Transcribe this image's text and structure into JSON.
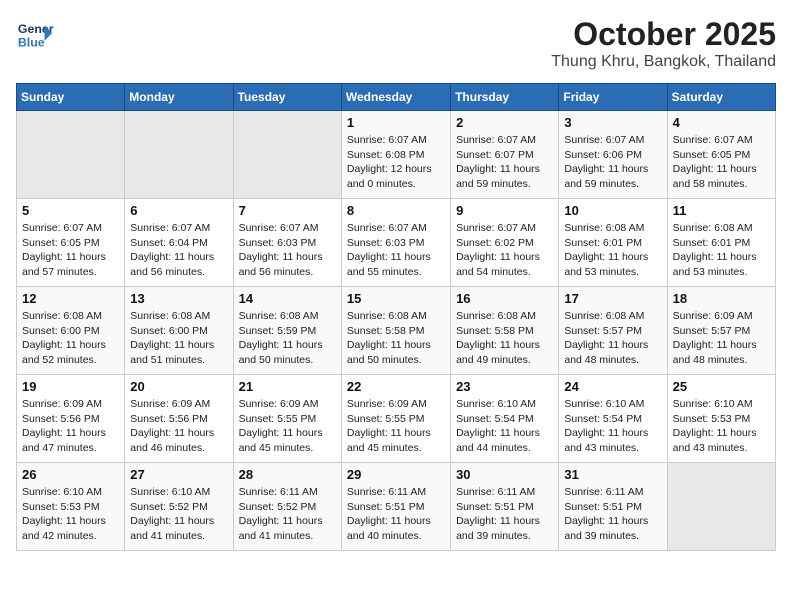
{
  "header": {
    "logo_general": "General",
    "logo_blue": "Blue",
    "month": "October 2025",
    "location": "Thung Khru, Bangkok, Thailand"
  },
  "weekdays": [
    "Sunday",
    "Monday",
    "Tuesday",
    "Wednesday",
    "Thursday",
    "Friday",
    "Saturday"
  ],
  "weeks": [
    [
      {
        "day": "",
        "detail": ""
      },
      {
        "day": "",
        "detail": ""
      },
      {
        "day": "",
        "detail": ""
      },
      {
        "day": "1",
        "detail": "Sunrise: 6:07 AM\nSunset: 6:08 PM\nDaylight: 12 hours\nand 0 minutes."
      },
      {
        "day": "2",
        "detail": "Sunrise: 6:07 AM\nSunset: 6:07 PM\nDaylight: 11 hours\nand 59 minutes."
      },
      {
        "day": "3",
        "detail": "Sunrise: 6:07 AM\nSunset: 6:06 PM\nDaylight: 11 hours\nand 59 minutes."
      },
      {
        "day": "4",
        "detail": "Sunrise: 6:07 AM\nSunset: 6:05 PM\nDaylight: 11 hours\nand 58 minutes."
      }
    ],
    [
      {
        "day": "5",
        "detail": "Sunrise: 6:07 AM\nSunset: 6:05 PM\nDaylight: 11 hours\nand 57 minutes."
      },
      {
        "day": "6",
        "detail": "Sunrise: 6:07 AM\nSunset: 6:04 PM\nDaylight: 11 hours\nand 56 minutes."
      },
      {
        "day": "7",
        "detail": "Sunrise: 6:07 AM\nSunset: 6:03 PM\nDaylight: 11 hours\nand 56 minutes."
      },
      {
        "day": "8",
        "detail": "Sunrise: 6:07 AM\nSunset: 6:03 PM\nDaylight: 11 hours\nand 55 minutes."
      },
      {
        "day": "9",
        "detail": "Sunrise: 6:07 AM\nSunset: 6:02 PM\nDaylight: 11 hours\nand 54 minutes."
      },
      {
        "day": "10",
        "detail": "Sunrise: 6:08 AM\nSunset: 6:01 PM\nDaylight: 11 hours\nand 53 minutes."
      },
      {
        "day": "11",
        "detail": "Sunrise: 6:08 AM\nSunset: 6:01 PM\nDaylight: 11 hours\nand 53 minutes."
      }
    ],
    [
      {
        "day": "12",
        "detail": "Sunrise: 6:08 AM\nSunset: 6:00 PM\nDaylight: 11 hours\nand 52 minutes."
      },
      {
        "day": "13",
        "detail": "Sunrise: 6:08 AM\nSunset: 6:00 PM\nDaylight: 11 hours\nand 51 minutes."
      },
      {
        "day": "14",
        "detail": "Sunrise: 6:08 AM\nSunset: 5:59 PM\nDaylight: 11 hours\nand 50 minutes."
      },
      {
        "day": "15",
        "detail": "Sunrise: 6:08 AM\nSunset: 5:58 PM\nDaylight: 11 hours\nand 50 minutes."
      },
      {
        "day": "16",
        "detail": "Sunrise: 6:08 AM\nSunset: 5:58 PM\nDaylight: 11 hours\nand 49 minutes."
      },
      {
        "day": "17",
        "detail": "Sunrise: 6:08 AM\nSunset: 5:57 PM\nDaylight: 11 hours\nand 48 minutes."
      },
      {
        "day": "18",
        "detail": "Sunrise: 6:09 AM\nSunset: 5:57 PM\nDaylight: 11 hours\nand 48 minutes."
      }
    ],
    [
      {
        "day": "19",
        "detail": "Sunrise: 6:09 AM\nSunset: 5:56 PM\nDaylight: 11 hours\nand 47 minutes."
      },
      {
        "day": "20",
        "detail": "Sunrise: 6:09 AM\nSunset: 5:56 PM\nDaylight: 11 hours\nand 46 minutes."
      },
      {
        "day": "21",
        "detail": "Sunrise: 6:09 AM\nSunset: 5:55 PM\nDaylight: 11 hours\nand 45 minutes."
      },
      {
        "day": "22",
        "detail": "Sunrise: 6:09 AM\nSunset: 5:55 PM\nDaylight: 11 hours\nand 45 minutes."
      },
      {
        "day": "23",
        "detail": "Sunrise: 6:10 AM\nSunset: 5:54 PM\nDaylight: 11 hours\nand 44 minutes."
      },
      {
        "day": "24",
        "detail": "Sunrise: 6:10 AM\nSunset: 5:54 PM\nDaylight: 11 hours\nand 43 minutes."
      },
      {
        "day": "25",
        "detail": "Sunrise: 6:10 AM\nSunset: 5:53 PM\nDaylight: 11 hours\nand 43 minutes."
      }
    ],
    [
      {
        "day": "26",
        "detail": "Sunrise: 6:10 AM\nSunset: 5:53 PM\nDaylight: 11 hours\nand 42 minutes."
      },
      {
        "day": "27",
        "detail": "Sunrise: 6:10 AM\nSunset: 5:52 PM\nDaylight: 11 hours\nand 41 minutes."
      },
      {
        "day": "28",
        "detail": "Sunrise: 6:11 AM\nSunset: 5:52 PM\nDaylight: 11 hours\nand 41 minutes."
      },
      {
        "day": "29",
        "detail": "Sunrise: 6:11 AM\nSunset: 5:51 PM\nDaylight: 11 hours\nand 40 minutes."
      },
      {
        "day": "30",
        "detail": "Sunrise: 6:11 AM\nSunset: 5:51 PM\nDaylight: 11 hours\nand 39 minutes."
      },
      {
        "day": "31",
        "detail": "Sunrise: 6:11 AM\nSunset: 5:51 PM\nDaylight: 11 hours\nand 39 minutes."
      },
      {
        "day": "",
        "detail": ""
      }
    ]
  ]
}
